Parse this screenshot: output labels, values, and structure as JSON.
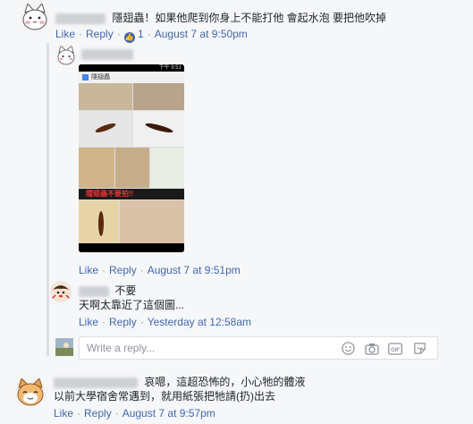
{
  "comment1": {
    "text": "隱翅蟲！如果他爬到你身上不能打他 會起水泡 要把他吹掉",
    "like": "Like",
    "reply": "Reply",
    "reaction_count": "1",
    "timestamp": "August 7 at 9:50pm"
  },
  "reply1": {
    "like": "Like",
    "reply": "Reply",
    "timestamp": "August 7 at 9:51pm",
    "image": {
      "status_time": "下午 9:51",
      "app_title": "隱翅蟲",
      "banner_text": "隱翅蟲不要拍!!"
    }
  },
  "reply2": {
    "line1": "不要",
    "line2": "天啊太靠近了這個圖...",
    "like": "Like",
    "reply": "Reply",
    "timestamp": "Yesterday at 12:58am"
  },
  "reply_box": {
    "placeholder": "Write a reply...",
    "icons": [
      "emoji-icon",
      "camera-icon",
      "gif-icon",
      "sticker-icon"
    ]
  },
  "comment2": {
    "line1": "哀嗯，這超恐怖的，小心牠的體液",
    "line2": "以前大學宿舍常遇到，就用紙張把牠請(扔)出去",
    "like": "Like",
    "reply": "Reply",
    "timestamp": "August 7 at 9:57pm"
  },
  "colors": {
    "link": "#4267b2",
    "meta": "#90949c",
    "bg": "#f6f7f9"
  }
}
